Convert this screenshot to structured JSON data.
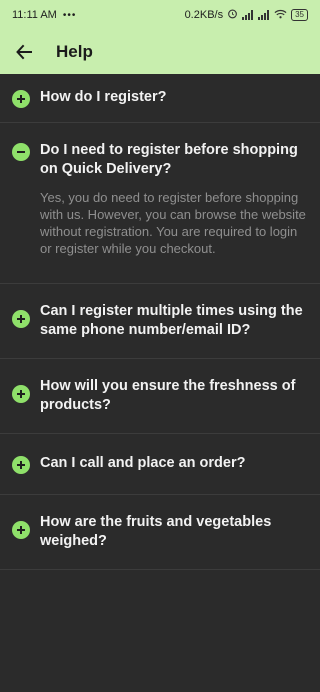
{
  "status_bar": {
    "time": "11:11 AM",
    "dots": "•••",
    "net_speed": "0.2KB/s",
    "battery": "35"
  },
  "app_bar": {
    "title": "Help"
  },
  "faq": [
    {
      "question": "How do I register?",
      "expanded": false,
      "answer": ""
    },
    {
      "question": "Do I need to register before shopping on Quick Delivery?",
      "expanded": true,
      "answer": "Yes, you do need to register before shopping with us. However, you can browse the website without registration. You are required to login or register while you checkout."
    },
    {
      "question": "Can I register multiple times using the same phone number/email ID?",
      "expanded": false,
      "answer": ""
    },
    {
      "question": "How will you ensure the freshness of products?",
      "expanded": false,
      "answer": ""
    },
    {
      "question": "Can I call and place an order?",
      "expanded": false,
      "answer": ""
    },
    {
      "question": "How are the fruits and vegetables weighed?",
      "expanded": false,
      "answer": ""
    }
  ],
  "colors": {
    "accent": "#8fe06a",
    "header_bg": "#c8eeae",
    "page_bg": "#2b2b2b"
  }
}
